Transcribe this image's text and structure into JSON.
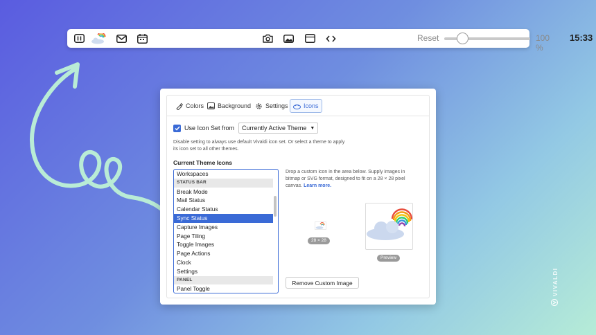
{
  "status_bar": {
    "icons": [
      "panel-toggle-icon",
      "sync-cloud-icon",
      "mail-icon",
      "calendar-icon",
      "capture-camera-icon",
      "image-icon",
      "page-tiling-icon",
      "page-actions-icon"
    ],
    "reset_label": "Reset",
    "zoom_level": "100 %",
    "clock": "15:33"
  },
  "panel": {
    "tabs": [
      {
        "label": "Colors",
        "icon": "palette-icon"
      },
      {
        "label": "Background",
        "icon": "image-icon"
      },
      {
        "label": "Settings",
        "icon": "gear-icon"
      },
      {
        "label": "Icons",
        "icon": "icons-icon"
      }
    ],
    "use_icon_set_label": "Use Icon Set from",
    "icon_set_value": "Currently Active Theme",
    "hint": "Disable setting to always use default Vivaldi icon set. Or select a theme to apply its icon set to all other themes.",
    "section_title": "Current Theme Icons",
    "list_items": [
      {
        "label": "Workspaces",
        "type": "item"
      },
      {
        "label": "STATUS BAR",
        "type": "header"
      },
      {
        "label": "Break Mode",
        "type": "item"
      },
      {
        "label": "Mail Status",
        "type": "item"
      },
      {
        "label": "Calendar Status",
        "type": "item"
      },
      {
        "label": "Sync Status",
        "type": "selected"
      },
      {
        "label": "Capture Images",
        "type": "item"
      },
      {
        "label": "Page Tiling",
        "type": "item"
      },
      {
        "label": "Toggle Images",
        "type": "item"
      },
      {
        "label": "Page Actions",
        "type": "item"
      },
      {
        "label": "Clock",
        "type": "item"
      },
      {
        "label": "Settings",
        "type": "item"
      },
      {
        "label": "PANEL",
        "type": "header"
      },
      {
        "label": "Panel Toggle",
        "type": "item"
      }
    ],
    "drop_hint": "Drop a custom icon in the area below. Supply images in bitmap or SVG format, designed to fit on a 28 × 28 pixel canvas.",
    "learn_more": "Learn more.",
    "size_badge": "28 × 28",
    "preview_badge": "Preview",
    "remove_button": "Remove Custom Image"
  },
  "watermark": "VIVALDI",
  "colors": {
    "accent": "#3a6ad6",
    "swirl": "#b9ecd6"
  }
}
